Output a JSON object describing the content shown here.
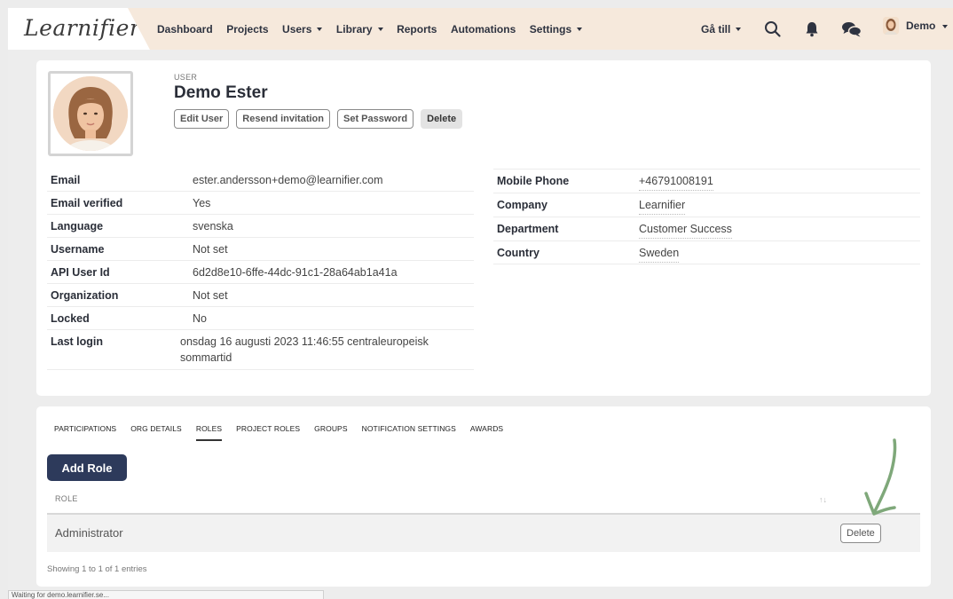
{
  "brand": {
    "logo_text": "Learnifier"
  },
  "nav": {
    "items": [
      {
        "label": "Dashboard",
        "dropdown": false
      },
      {
        "label": "Projects",
        "dropdown": false
      },
      {
        "label": "Users",
        "dropdown": true
      },
      {
        "label": "Library",
        "dropdown": true
      },
      {
        "label": "Reports",
        "dropdown": false
      },
      {
        "label": "Automations",
        "dropdown": false
      },
      {
        "label": "Settings",
        "dropdown": true
      }
    ],
    "goto_label": "Gå till",
    "user_label": "Demo"
  },
  "profile": {
    "section_label": "USER",
    "name": "Demo Ester",
    "actions": {
      "edit": "Edit User",
      "resend": "Resend invitation",
      "password": "Set Password",
      "delete": "Delete"
    },
    "left_fields": [
      {
        "label": "Email",
        "value": "ester.andersson+demo@learnifier.com"
      },
      {
        "label": "Email verified",
        "value": "Yes"
      },
      {
        "label": "Language",
        "value": "svenska"
      },
      {
        "label": "Username",
        "value": "Not set"
      },
      {
        "label": "API User Id",
        "value": "6d2d8e10-6ffe-44dc-91c1-28a64ab1a41a"
      },
      {
        "label": "Organization",
        "value": "Not set"
      },
      {
        "label": "Locked",
        "value": "No"
      },
      {
        "label": "Last login",
        "value": "onsdag 16 augusti 2023 11:46:55 centraleuropeisk sommartid"
      }
    ],
    "right_fields": [
      {
        "label": "Mobile Phone",
        "value": "+46791008191"
      },
      {
        "label": "Company",
        "value": "Learnifier"
      },
      {
        "label": "Department",
        "value": "Customer Success"
      },
      {
        "label": "Country",
        "value": "Sweden"
      }
    ]
  },
  "tabs": {
    "items": [
      "PARTICIPATIONS",
      "ORG DETAILS",
      "ROLES",
      "PROJECT ROLES",
      "GROUPS",
      "NOTIFICATION SETTINGS",
      "AWARDS"
    ],
    "active": "ROLES"
  },
  "roles": {
    "add_button": "Add Role",
    "column_header": "ROLE",
    "sort_glyph": "↑↓",
    "rows": [
      {
        "role": "Administrator",
        "delete_label": "Delete"
      }
    ],
    "footer": "Showing 1 to 1 of 1 entries"
  },
  "status_bar": "Waiting for demo.learnifier.se...",
  "colors": {
    "topbar_bg": "#f6e9dc",
    "primary_button": "#2d3a5b",
    "annotation_arrow": "#7fa87a"
  }
}
